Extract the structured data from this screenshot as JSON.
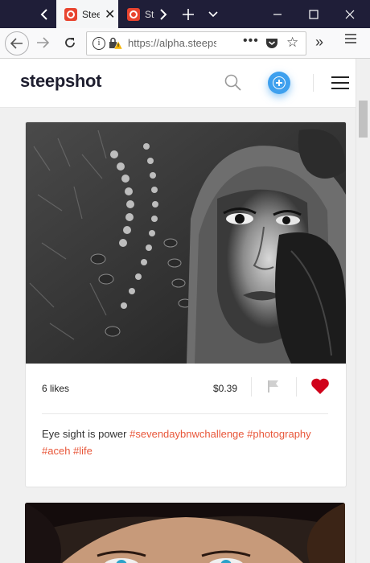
{
  "browser": {
    "tabs": [
      {
        "title": "Steepshot",
        "active": true
      },
      {
        "title": "Steepshot",
        "active": false
      }
    ],
    "url": "https://alpha.steepshot.io",
    "page_actions_label": "•••"
  },
  "site": {
    "logo": "steepshot",
    "accent_color": "#3ea0ee"
  },
  "post": {
    "likes": "6 likes",
    "payout": "$0.39",
    "caption": "Eye sight is power",
    "tags": [
      "#sevendaybnwchallenge",
      "#photography",
      "#aceh",
      "#life"
    ],
    "liked": true,
    "heart_color": "#d0021b",
    "tag_color": "#e8573a"
  }
}
